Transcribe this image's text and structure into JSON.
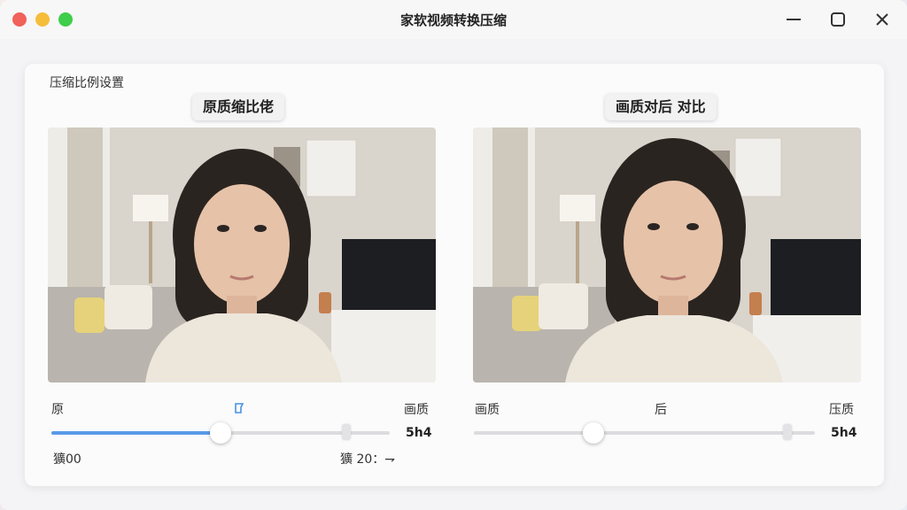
{
  "window": {
    "title": "家软视频转换压缩",
    "accent": "#5a9ae8"
  },
  "panel": {
    "section_label": "压缩比例设置",
    "left": {
      "pill": "原质缩比佬",
      "left_label": "原",
      "right_label": "画质",
      "value": "5h4",
      "bottom_left": "獷00",
      "bottom_right": "獷 20：⇁",
      "slider_level": 0.5
    },
    "right": {
      "pill": "画质对后 对比",
      "left_label": "画质",
      "center_label": "后",
      "right_label": "压质",
      "value": "5h4",
      "slider_level": 0.35
    }
  },
  "icons": [
    "close-icon",
    "minimize-icon",
    "maximize-icon",
    "edit-icon"
  ]
}
